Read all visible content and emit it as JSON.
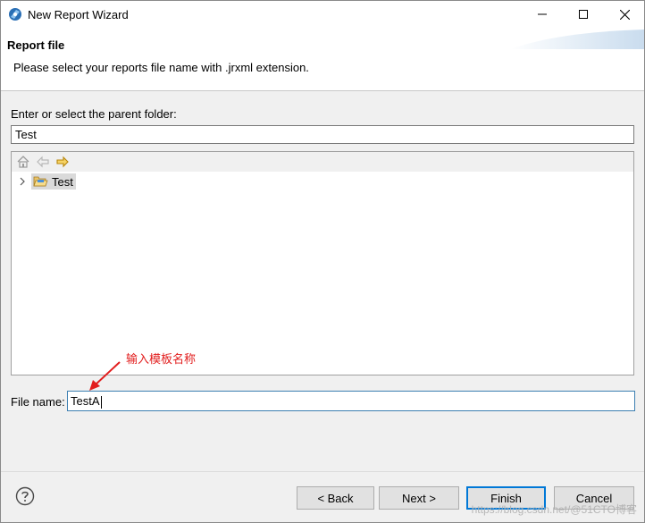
{
  "window": {
    "title": "New Report Wizard",
    "controls": {
      "minimize": "minimize",
      "maximize": "maximize",
      "close": "close"
    }
  },
  "header": {
    "title": "Report file",
    "description": "Please select your reports file name with .jrxml extension."
  },
  "parent_folder": {
    "label": "Enter or select the parent folder:",
    "value": "Test"
  },
  "tree": {
    "toolbar_icons": [
      "home-icon",
      "back-arrow-icon",
      "forward-arrow-icon"
    ],
    "items": [
      {
        "label": "Test",
        "icon": "open-folder-icon",
        "selected": true
      }
    ]
  },
  "annotation": {
    "text": "输入模板名称",
    "color": "#e21d1d"
  },
  "file_name": {
    "label": "File name:",
    "value": "TestA"
  },
  "buttons": {
    "back": "< Back",
    "next": "Next >",
    "finish": "Finish",
    "cancel": "Cancel"
  },
  "watermark": "https://blog.csdn.net/@51CTO博客"
}
